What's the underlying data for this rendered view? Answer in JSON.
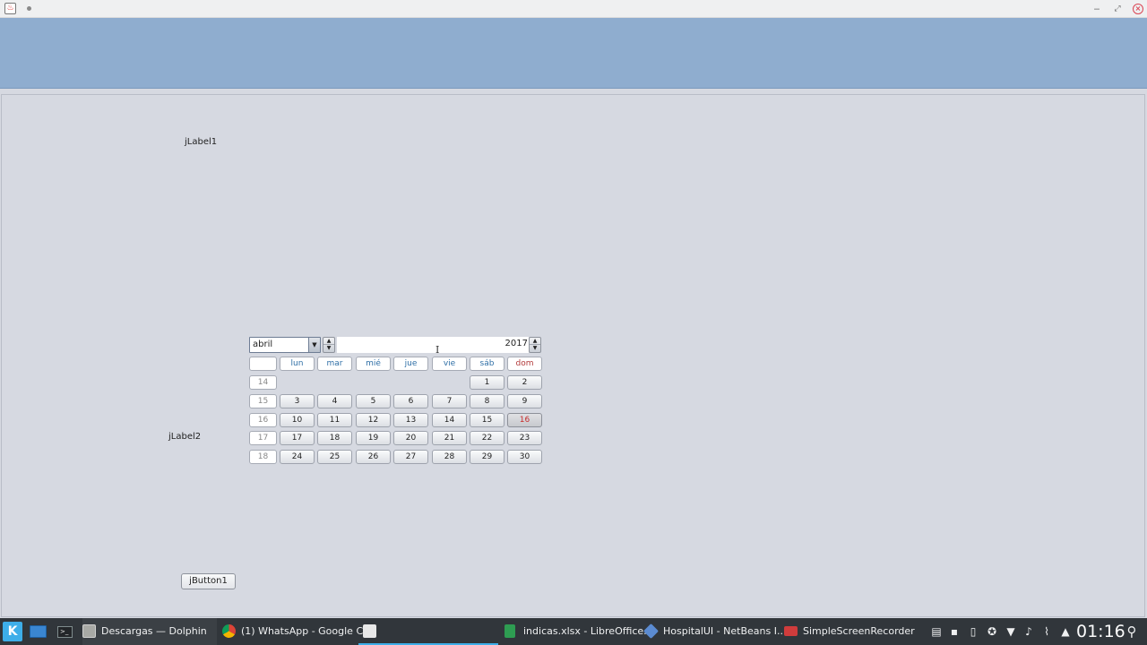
{
  "window": {
    "icon": "java-icon",
    "close_glyph": "×",
    "minimize_glyph": "‒",
    "maximize_glyph": "⤢"
  },
  "labels": {
    "label1": "jLabel1",
    "label2": "jLabel2"
  },
  "button": {
    "button1": "jButton1"
  },
  "calendar": {
    "month": "abril",
    "year": "2017",
    "headers": [
      "lun",
      "mar",
      "mié",
      "jue",
      "vie",
      "sáb",
      "dom"
    ],
    "weeks": [
      {
        "week": "14",
        "days": [
          "",
          "",
          "",
          "",
          "",
          "1",
          "2"
        ]
      },
      {
        "week": "15",
        "days": [
          "3",
          "4",
          "5",
          "6",
          "7",
          "8",
          "9"
        ]
      },
      {
        "week": "16",
        "days": [
          "10",
          "11",
          "12",
          "13",
          "14",
          "15",
          "16"
        ]
      },
      {
        "week": "17",
        "days": [
          "17",
          "18",
          "19",
          "20",
          "21",
          "22",
          "23"
        ]
      },
      {
        "week": "18",
        "days": [
          "24",
          "25",
          "26",
          "27",
          "28",
          "29",
          "30"
        ]
      }
    ],
    "selected_day": "16"
  },
  "taskbar": {
    "tasks": [
      {
        "label": "Descargas — Dolphin",
        "icon": "dolphin-icon"
      },
      {
        "label": "(1) WhatsApp - Google C...",
        "icon": "chrome-icon"
      },
      {
        "label": "",
        "icon": "java-icon"
      },
      {
        "label": "indicas.xlsx - LibreOffice...",
        "icon": "libreoffice-calc-icon"
      },
      {
        "label": "HospitalUI - NetBeans I...",
        "icon": "netbeans-icon"
      },
      {
        "label": "SimpleScreenRecorder",
        "icon": "screen-recorder-icon"
      }
    ],
    "clock": "01:16"
  },
  "colors": {
    "header_panel": "#8fadcf",
    "panel_bg": "#d6d9e1",
    "taskbar": "#31363b",
    "accent": "#3daee9",
    "sunday": "#b23a3a"
  }
}
